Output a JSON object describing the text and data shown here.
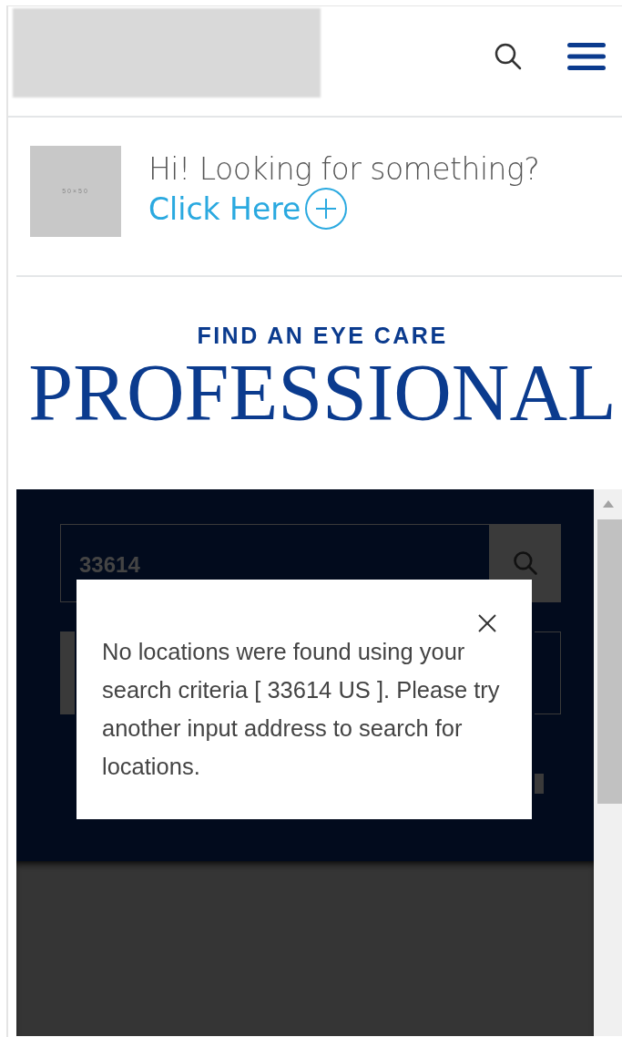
{
  "promo": {
    "thumbnail_label": "50×50",
    "question": "Hi! Looking for something?",
    "link": "Click Here"
  },
  "heading": {
    "eyebrow": "FIND AN EYE CARE",
    "title": "PROFESSIONAL"
  },
  "locator": {
    "search_value": "33614"
  },
  "dialog": {
    "message": "No locations were found using your search criteria [ 33614 US ]. Please try another input address to search for locations."
  }
}
